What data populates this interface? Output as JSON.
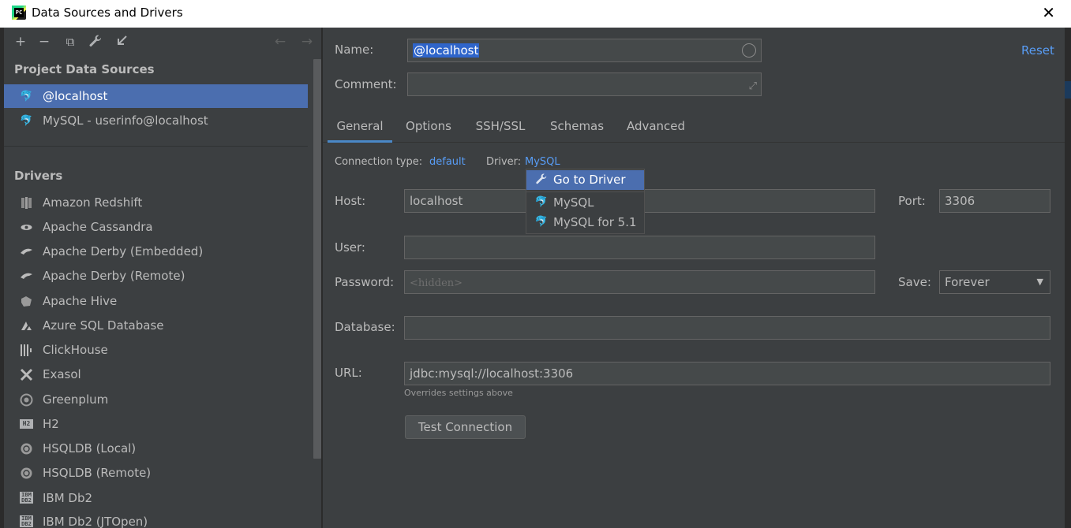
{
  "window": {
    "title": "Data Sources and Drivers",
    "app_badge": "PC"
  },
  "toolbar": {
    "add": "+",
    "remove": "−",
    "duplicate": "⧉",
    "settings": "🔧",
    "import": "⇲",
    "back": "←",
    "forward": "→"
  },
  "project": {
    "section_title": "Project Data Sources",
    "items": [
      {
        "label": "@localhost",
        "selected": true
      },
      {
        "label": "MySQL - userinfo@localhost",
        "selected": false
      }
    ]
  },
  "drivers": {
    "section_title": "Drivers",
    "items": [
      {
        "label": "Amazon Redshift",
        "icon": "redshift-icon"
      },
      {
        "label": "Apache Cassandra",
        "icon": "cassandra-icon"
      },
      {
        "label": "Apache Derby (Embedded)",
        "icon": "derby-icon"
      },
      {
        "label": "Apache Derby (Remote)",
        "icon": "derby-icon"
      },
      {
        "label": "Apache Hive",
        "icon": "hive-icon"
      },
      {
        "label": "Azure SQL Database",
        "icon": "azure-icon"
      },
      {
        "label": "ClickHouse",
        "icon": "clickhouse-icon"
      },
      {
        "label": "Exasol",
        "icon": "exasol-icon"
      },
      {
        "label": "Greenplum",
        "icon": "greenplum-icon"
      },
      {
        "label": "H2",
        "icon": "h2-icon",
        "badge": "H2"
      },
      {
        "label": "HSQLDB (Local)",
        "icon": "hsqldb-icon"
      },
      {
        "label": "HSQLDB (Remote)",
        "icon": "hsqldb-icon"
      },
      {
        "label": "IBM Db2",
        "icon": "db2-icon",
        "badge": "IBM DB2"
      },
      {
        "label": "IBM Db2 (JTOpen)",
        "icon": "db2-icon",
        "badge": "IBM DB2"
      }
    ]
  },
  "form": {
    "name_label": "Name:",
    "name_value": "@localhost",
    "comment_label": "Comment:",
    "comment_value": "",
    "reset": "Reset",
    "tabs": [
      "General",
      "Options",
      "SSH/SSL",
      "Schemas",
      "Advanced"
    ],
    "active_tab": "General",
    "connection_type_label": "Connection type:",
    "connection_type_value": "default",
    "driver_label": "Driver:",
    "driver_value": "MySQL",
    "host_label": "Host:",
    "host_value": "localhost",
    "port_label": "Port:",
    "port_value": "3306",
    "user_label": "User:",
    "user_value": "",
    "password_label": "Password:",
    "password_placeholder": "<hidden>",
    "save_label": "Save:",
    "save_value": "Forever",
    "database_label": "Database:",
    "database_value": "",
    "url_label": "URL:",
    "url_value": "jdbc:mysql://localhost:3306",
    "url_hint": "Overrides settings above",
    "test_connection": "Test Connection"
  },
  "driver_popup": {
    "items": [
      {
        "label": "Go to Driver",
        "icon": "wrench-icon",
        "highlighted": true
      },
      {
        "label": "MySQL",
        "icon": "mysql-icon",
        "highlighted": false
      },
      {
        "label": "MySQL for 5.1",
        "icon": "mysql-icon",
        "highlighted": false
      }
    ]
  },
  "colors": {
    "selection": "#4b6eaf",
    "link": "#589df6",
    "panel": "#3c3f41"
  }
}
